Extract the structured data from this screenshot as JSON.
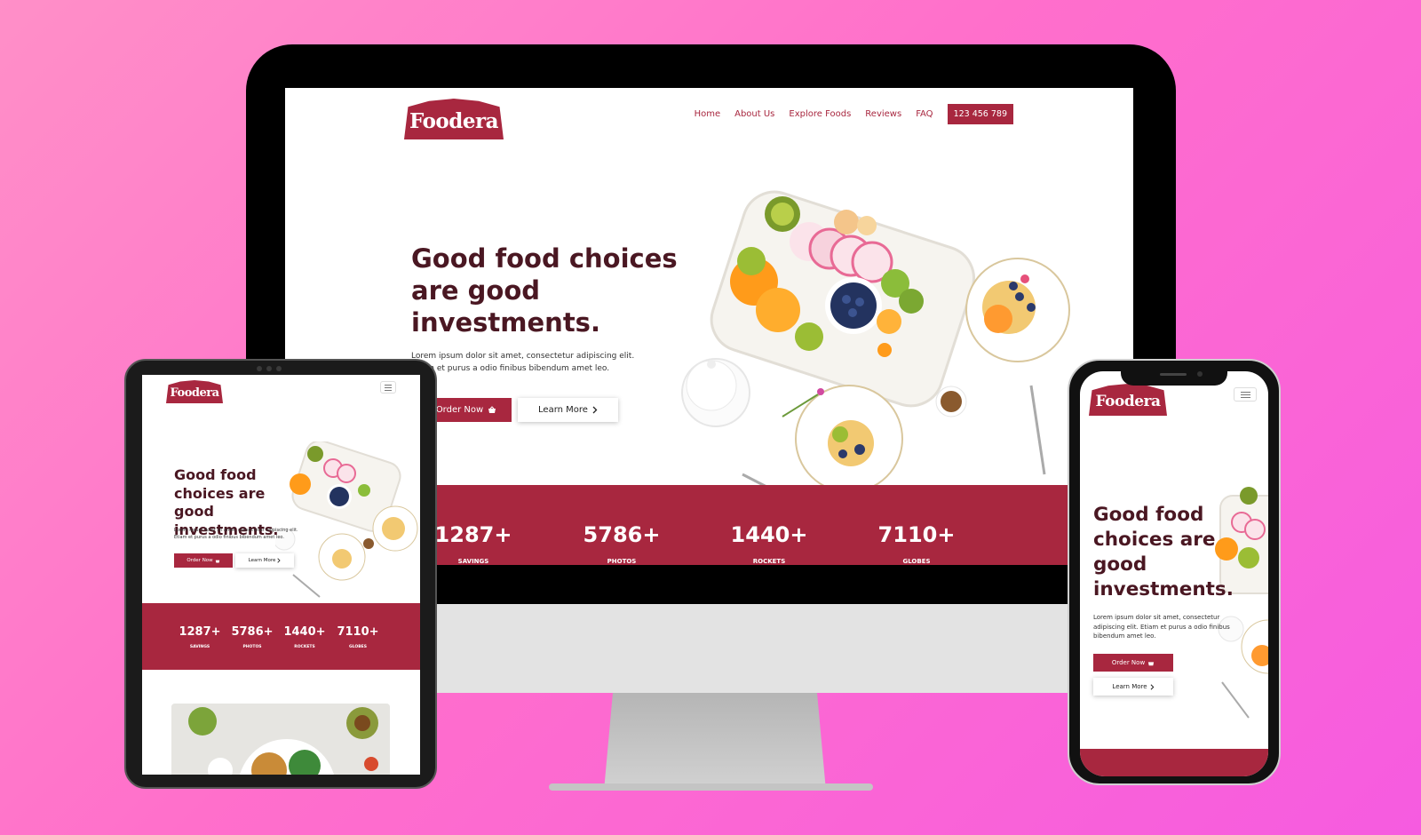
{
  "brand": {
    "name": "Foodera",
    "color": "#a8273f",
    "bg_gradient": [
      "#ff8fc8",
      "#f65be0"
    ]
  },
  "nav": {
    "items": [
      "Home",
      "About Us",
      "Explore Foods",
      "Reviews",
      "FAQ"
    ],
    "phone": "123 456 789"
  },
  "hero": {
    "title": "Good food choices are good investments.",
    "paragraph": "Lorem ipsum dolor sit amet, consectetur adipiscing elit. Etiam et purus a odio finibus bibendum amet leo.",
    "order_label": "Order Now",
    "order_icon": "basket-icon",
    "learn_label": "Learn More",
    "learn_icon": "chevron-right-icon"
  },
  "stats": [
    {
      "value": "1287+",
      "label": "SAVINGS"
    },
    {
      "value": "5786+",
      "label": "PHOTOS"
    },
    {
      "value": "1440+",
      "label": "ROCKETS"
    },
    {
      "value": "7110+",
      "label": "GLOBES"
    }
  ],
  "mobile_menu_icon": "hamburger-menu-icon",
  "devices": [
    "desktop-monitor",
    "tablet",
    "phone"
  ]
}
